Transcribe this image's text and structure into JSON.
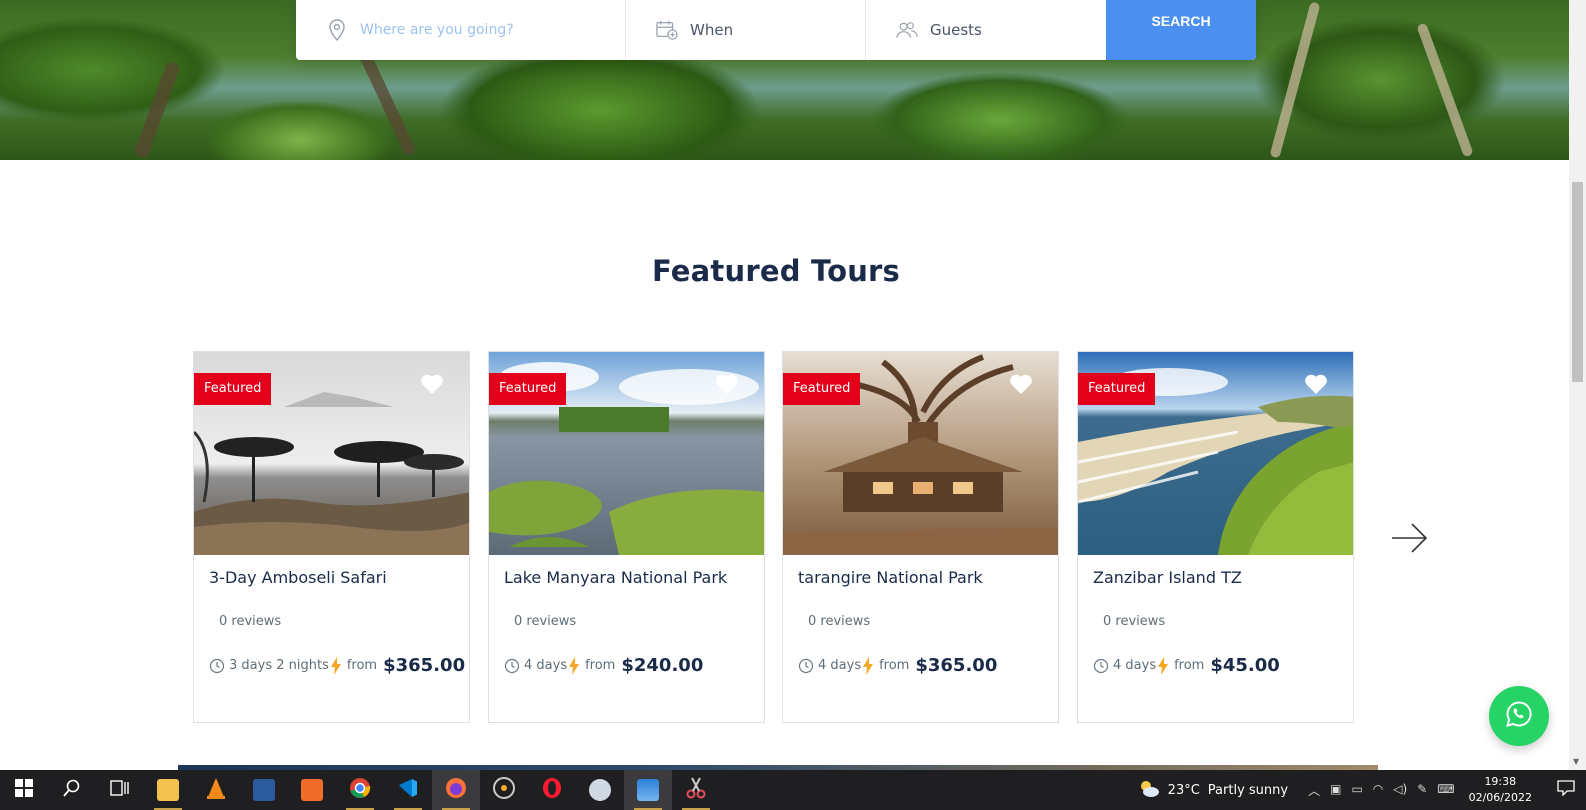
{
  "search": {
    "where_placeholder": "Where are you going?",
    "when_label": "When",
    "guests_label": "Guests",
    "search_button": "SEARCH"
  },
  "section": {
    "title": "Featured Tours"
  },
  "tours": [
    {
      "badge": "Featured",
      "name": "3-Day Amboseli Safari",
      "reviews": "0 reviews",
      "duration": "3 days 2 nights",
      "from": "from",
      "price": "$365.00"
    },
    {
      "badge": "Featured",
      "name": "Lake Manyara National Park",
      "reviews": "0 reviews",
      "duration": "4 days",
      "from": "from",
      "price": "$240.00"
    },
    {
      "badge": "Featured",
      "name": "tarangire National Park",
      "reviews": "0 reviews",
      "duration": "4 days",
      "from": "from",
      "price": "$365.00"
    },
    {
      "badge": "Featured",
      "name": "Zanzibar Island TZ",
      "reviews": "0 reviews",
      "duration": "4 days",
      "from": "from",
      "price": "$45.00"
    }
  ],
  "taskbar": {
    "weather_temp": "23°C",
    "weather_desc": "Partly sunny",
    "time": "19:38",
    "date": "02/06/2022",
    "apps": [
      "file-explorer",
      "vlc",
      "xampp-alt",
      "xampp",
      "chrome",
      "vscode",
      "firefox",
      "media",
      "opera",
      "app",
      "photos",
      "snipping-tool"
    ]
  },
  "colors": {
    "accent": "#4b8ff0",
    "badge": "#e3001b",
    "heading": "#1a2b49",
    "whatsapp": "#25d366",
    "bolt": "#f5a623"
  }
}
